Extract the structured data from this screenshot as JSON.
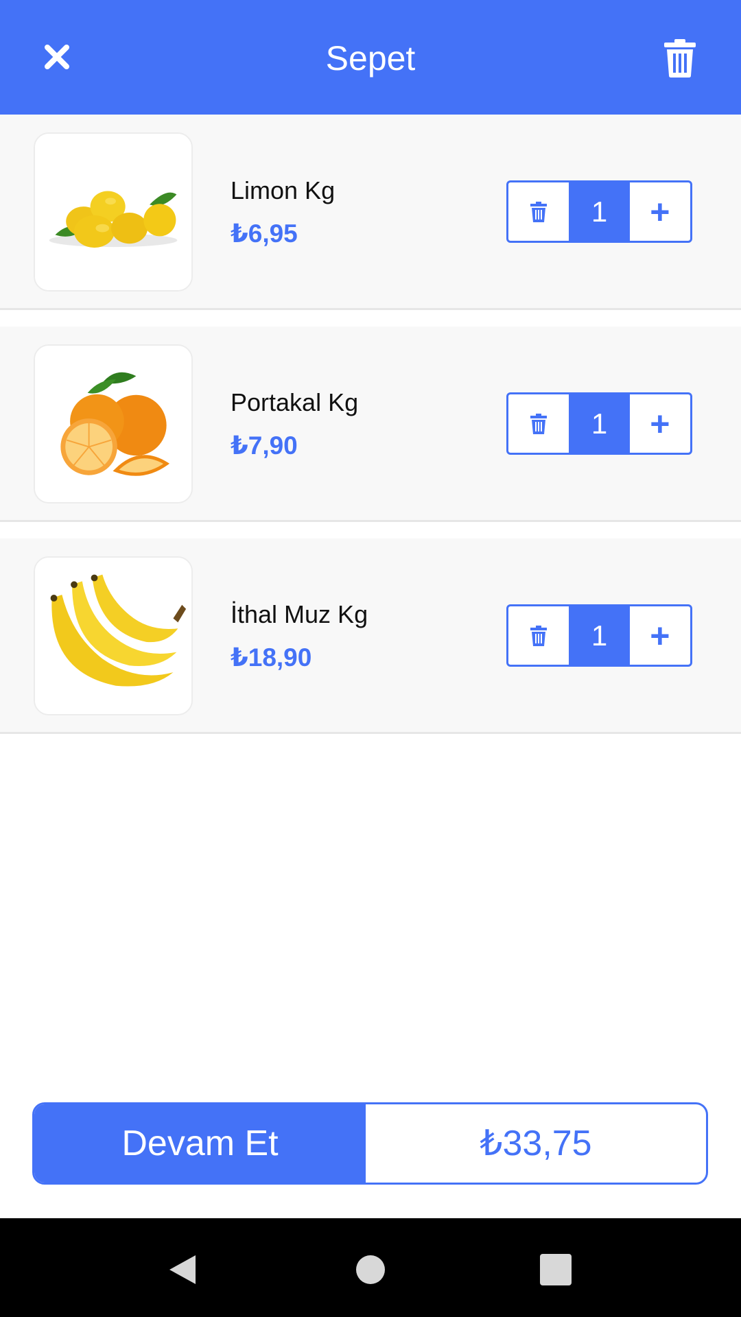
{
  "header": {
    "title": "Sepet",
    "close_icon": "close-icon",
    "clear_icon": "trash-icon"
  },
  "colors": {
    "accent": "#4472f7",
    "item_background": "#f8f8f8",
    "navbar": "#000000"
  },
  "cart": {
    "items": [
      {
        "name": "Limon Kg",
        "price": "₺6,95",
        "quantity": "1",
        "image": "lemon-image"
      },
      {
        "name": "Portakal Kg",
        "price": "₺7,90",
        "quantity": "1",
        "image": "orange-image"
      },
      {
        "name": "İthal Muz Kg",
        "price": "₺18,90",
        "quantity": "1",
        "image": "banana-image"
      }
    ],
    "increment_label": "+",
    "remove_icon": "trash-icon"
  },
  "footer": {
    "continue_label": "Devam Et",
    "total": "₺33,75"
  },
  "navbar": {
    "back_icon": "back-triangle-icon",
    "home_icon": "home-circle-icon",
    "recents_icon": "recents-square-icon"
  }
}
